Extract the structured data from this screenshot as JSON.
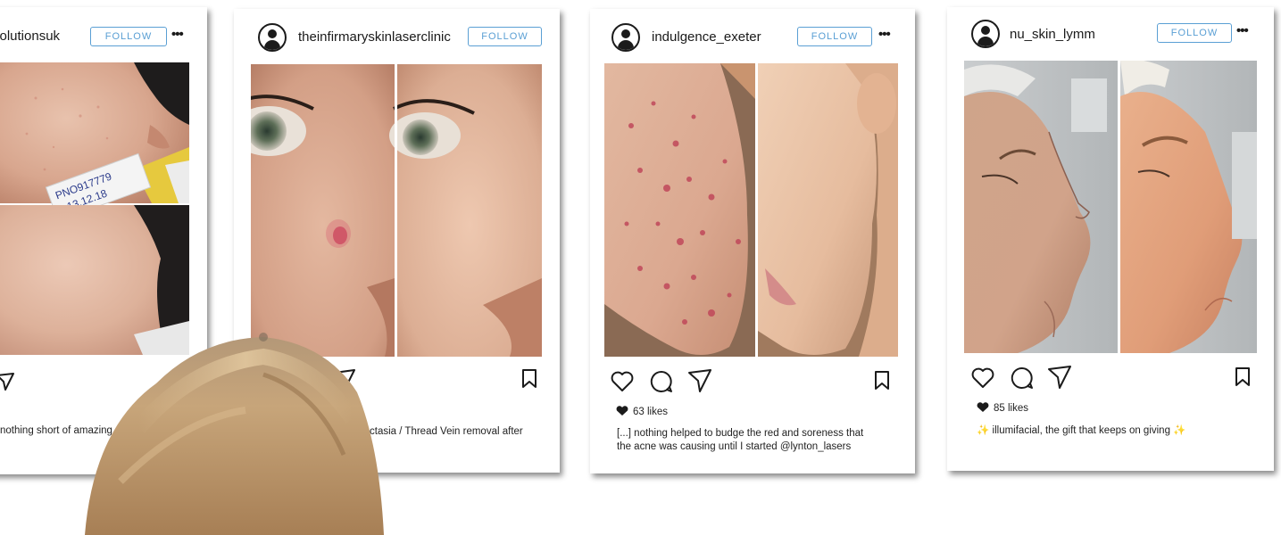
{
  "posts": [
    {
      "username": "solutionsuk",
      "follow_label": "FOLLOW",
      "more": "•••",
      "caption": "nothing short of amazing",
      "photo_label_line1": "PNO917779",
      "photo_label_line2": "13.12.18"
    },
    {
      "username": "theinfirmaryskinlaserclinic",
      "follow_label": "FOLLOW",
      "caption": "ctasia / Thread Vein removal after"
    },
    {
      "username": "indulgence_exeter",
      "follow_label": "FOLLOW",
      "more": "•••",
      "likes": "63 likes",
      "caption_line1": "[...] nothing helped to budge the red and soreness that",
      "caption_line2": "the acne was causing until I started @lynton_lasers"
    },
    {
      "username": "nu_skin_lymm",
      "follow_label": "FOLLOW",
      "more": "•••",
      "likes": "85 likes",
      "caption": "illumifacial, the gift that keeps on giving",
      "caption_emoji_left": "✨",
      "caption_emoji_right": "✨"
    }
  ],
  "colors": {
    "follow_blue": "#5a9fd4",
    "icon_dark": "#1b1b1b"
  }
}
